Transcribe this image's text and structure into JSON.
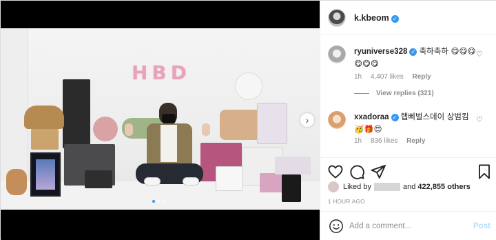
{
  "post": {
    "username": "k.kbeom",
    "verified": true,
    "image": {
      "banner_text": "HBD",
      "carousel_dots": 3,
      "active_dot": 1
    }
  },
  "comments": [
    {
      "username": "ryuniverse328",
      "verified": true,
      "text": "축하축하 😋😋😋😋😋😋",
      "time": "1h",
      "likes": "4,407 likes",
      "reply_label": "Reply",
      "view_replies": "View replies (321)"
    },
    {
      "username": "xxadoraa",
      "verified": true,
      "text": "햅삐벌스데이 상범킴 🥳🎁😍",
      "time": "1h",
      "likes": "836 likes",
      "reply_label": "Reply"
    }
  ],
  "likes_summary": {
    "prefix": "Liked by",
    "and": "and",
    "count": "422,855 others"
  },
  "timestamp": "1 HOUR AGO",
  "add_comment": {
    "placeholder": "Add a comment...",
    "post_label": "Post"
  },
  "icons": {
    "verified": "verified-check-icon",
    "like": "heart-icon",
    "comment": "comment-bubble-icon",
    "share": "paper-plane-icon",
    "save": "bookmark-icon",
    "emoji": "smiley-icon",
    "next": "chevron-right-icon"
  },
  "colors": {
    "accent": "#3897f0",
    "post_button_disabled": "#b2dffc",
    "meta_text": "#8e8e8e"
  }
}
